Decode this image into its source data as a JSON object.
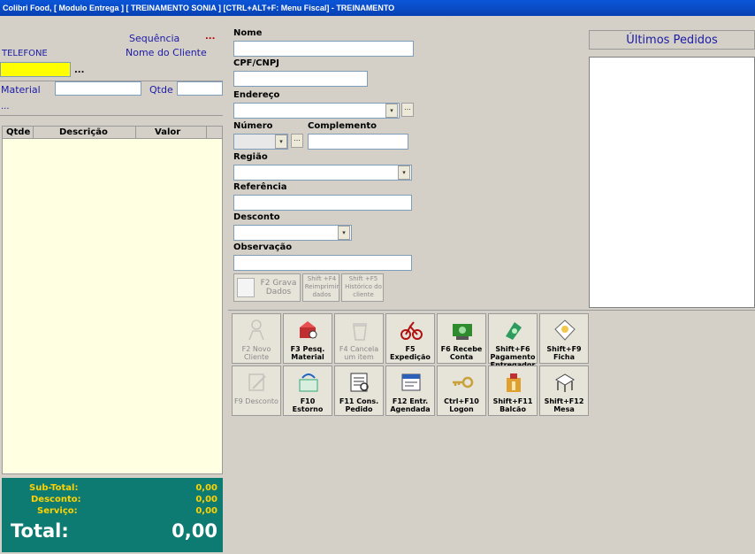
{
  "window": {
    "title": "Colibri Food, [ Modulo Entrega ] [ TREINAMENTO SONIA ] [CTRL+ALT+F: Menu Fiscal] - TREINAMENTO"
  },
  "left": {
    "sequencia_label": "Sequência",
    "sequencia_dots": "...",
    "telefone_label": "TELEFONE",
    "nome_cliente_label": "Nome do Cliente",
    "telefone_dots": "...",
    "material_label": "Material",
    "qtde_label": "Qtde",
    "material_dots": "...",
    "columns": [
      "Qtde",
      "Descrição",
      "Valor"
    ]
  },
  "totals": {
    "subtotal_label": "Sub-Total:",
    "subtotal": "0,00",
    "desconto_label": "Desconto:",
    "desconto": "0,00",
    "servico_label": "Serviço:",
    "servico": "0,00",
    "total_label": "Total:",
    "total": "0,00"
  },
  "form": {
    "nome": "Nome",
    "cpf": "CPF/CNPJ",
    "endereco": "Endereço",
    "numero": "Número",
    "complemento": "Complemento",
    "regiao": "Região",
    "referencia": "Referência",
    "desconto": "Desconto",
    "observacao": "Observação",
    "btn_grava": "F2 Grava Dados",
    "btn_reimprimir": "Shift +F4 Reimprimir dados",
    "btn_historico": "Shift +F5 Histórico do cliente"
  },
  "ultimos": {
    "title": "Últimos Pedidos"
  },
  "toolbar": {
    "row1": [
      {
        "label": "F2 Novo Cliente",
        "enabled": false,
        "icon": "new-client-icon"
      },
      {
        "label": "F3 Pesq. Material",
        "enabled": true,
        "icon": "search-material-icon"
      },
      {
        "label": "F4 Cancela um item",
        "enabled": false,
        "icon": "trash-icon"
      },
      {
        "label": "F5 Expedição",
        "enabled": true,
        "icon": "bicycle-icon"
      },
      {
        "label": "F6 Recebe Conta",
        "enabled": true,
        "icon": "cash-icon"
      },
      {
        "label": "Shift+F6 Pagamento Entregador",
        "enabled": true,
        "icon": "payment-icon"
      },
      {
        "label": "Shift+F9 Ficha",
        "enabled": true,
        "icon": "ticket-icon"
      }
    ],
    "row2": [
      {
        "label": "F9 Desconto",
        "enabled": false,
        "icon": "discount-icon"
      },
      {
        "label": "F10 Estorno",
        "enabled": true,
        "icon": "refund-icon"
      },
      {
        "label": "F11 Cons. Pedido",
        "enabled": true,
        "icon": "order-lookup-icon"
      },
      {
        "label": "F12 Entr. Agendada",
        "enabled": true,
        "icon": "scheduled-icon"
      },
      {
        "label": "Ctrl+F10 Logon",
        "enabled": true,
        "icon": "key-icon"
      },
      {
        "label": "Shift+F11 Balcão",
        "enabled": true,
        "icon": "counter-icon"
      },
      {
        "label": "Shift+F12 Mesa",
        "enabled": true,
        "icon": "table-icon"
      }
    ]
  },
  "colors": {
    "title_bar": "#0a56d8",
    "list_bg": "#ffffe1",
    "totals_bg": "#0e7b73",
    "totals_text": "#ffd200",
    "telefone_field": "#ffff00"
  }
}
